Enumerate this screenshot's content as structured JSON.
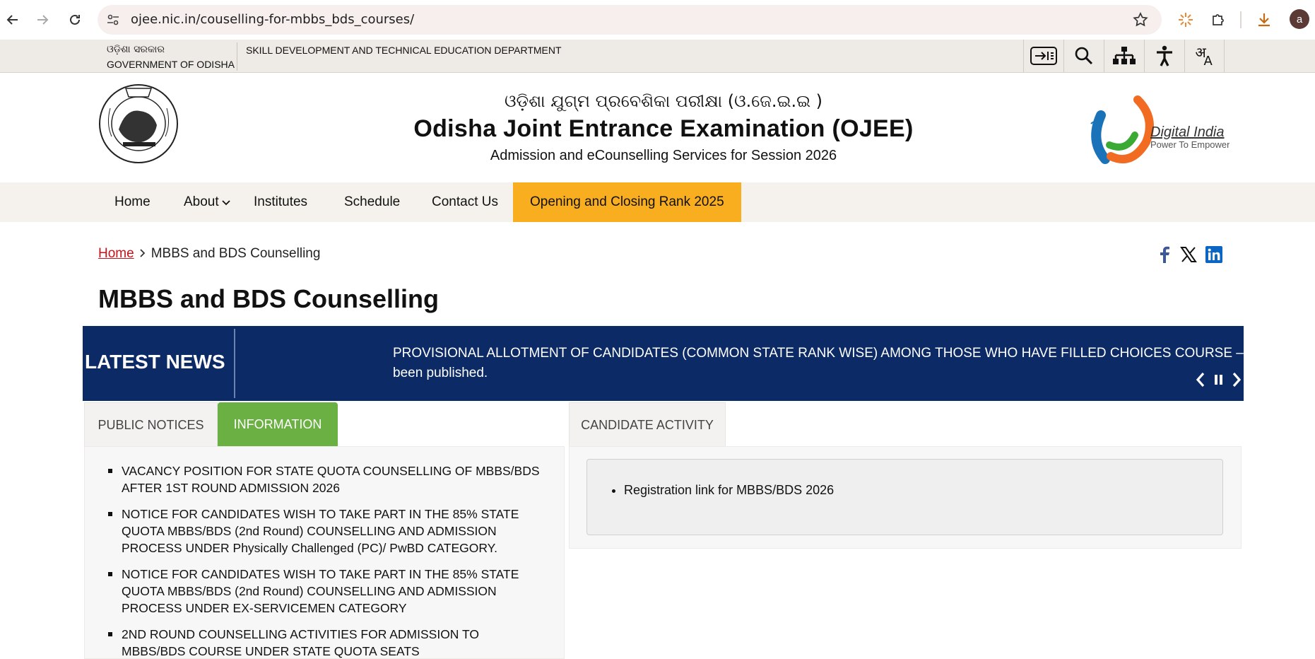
{
  "browser": {
    "url": "ojee.nic.in/couselling-for-mbbs_bds_courses/",
    "profile_initial": "a"
  },
  "govbar": {
    "gov_odia": "ଓଡ଼ିଶା ସରକାର",
    "gov_en": "GOVERNMENT OF ODISHA",
    "department": "SKILL DEVELOPMENT AND TECHNICAL EDUCATION DEPARTMENT",
    "lang_a1": "अ",
    "lang_a2": "A"
  },
  "header": {
    "title_odia": "ଓଡ଼ିଶା ଯୁଗ୍ମ ପ୍ରବେଶିକା ପରୀକ୍ଷା (ଓ.ଜେ.ଇ.ଇ )",
    "title_main": "Odisha Joint Entrance Examination (OJEE)",
    "title_sub": "Admission and eCounselling Services for Session 2026",
    "digital_india": "Digital India",
    "digital_india_tag": "Power To Empower"
  },
  "nav": {
    "home": "Home",
    "about": "About",
    "institutes": "Institutes",
    "schedule": "Schedule",
    "contact": "Contact Us",
    "rank": "Opening and Closing Rank 2025"
  },
  "breadcrumb": {
    "home": "Home",
    "current": "MBBS and BDS Counselling"
  },
  "page": {
    "title": "MBBS and BDS Counselling"
  },
  "news": {
    "label": "LATEST NEWS",
    "line1": "PROVISIONAL ALLOTMENT OF CANDIDATES (COMMON STATE RANK WISE) AMONG THOSE WHO HAVE FILLED CHOICES COURSE – MBBS/BI",
    "line2": "been published."
  },
  "tabs_left": {
    "public_notices": "PUBLIC NOTICES",
    "information": "INFORMATION"
  },
  "notices": [
    "VACANCY POSITION FOR STATE QUOTA COUNSELLING OF MBBS/BDS AFTER 1ST ROUND ADMISSION 2026",
    "NOTICE FOR CANDIDATES WISH TO TAKE PART IN THE 85% STATE QUOTA MBBS/BDS (2nd Round) COUNSELLING AND ADMISSION PROCESS UNDER Physically Challenged (PC)/ PwBD CATEGORY.",
    "NOTICE FOR CANDIDATES WISH TO TAKE PART IN THE 85% STATE QUOTA MBBS/BDS (2nd Round) COUNSELLING AND ADMISSION PROCESS UNDER EX-SERVICEMEN CATEGORY",
    "2ND ROUND COUNSELLING ACTIVITIES FOR ADMISSION TO MBBS/BDS COURSE UNDER STATE QUOTA SEATS"
  ],
  "activity": {
    "tab": "CANDIDATE ACTIVITY",
    "items": [
      "Registration link for MBBS/BDS 2026"
    ]
  },
  "colors": {
    "news_bg": "#0c2a66",
    "active_nav": "#f9ae20",
    "info_tab": "#6bb043",
    "link_red": "#c3141b"
  }
}
